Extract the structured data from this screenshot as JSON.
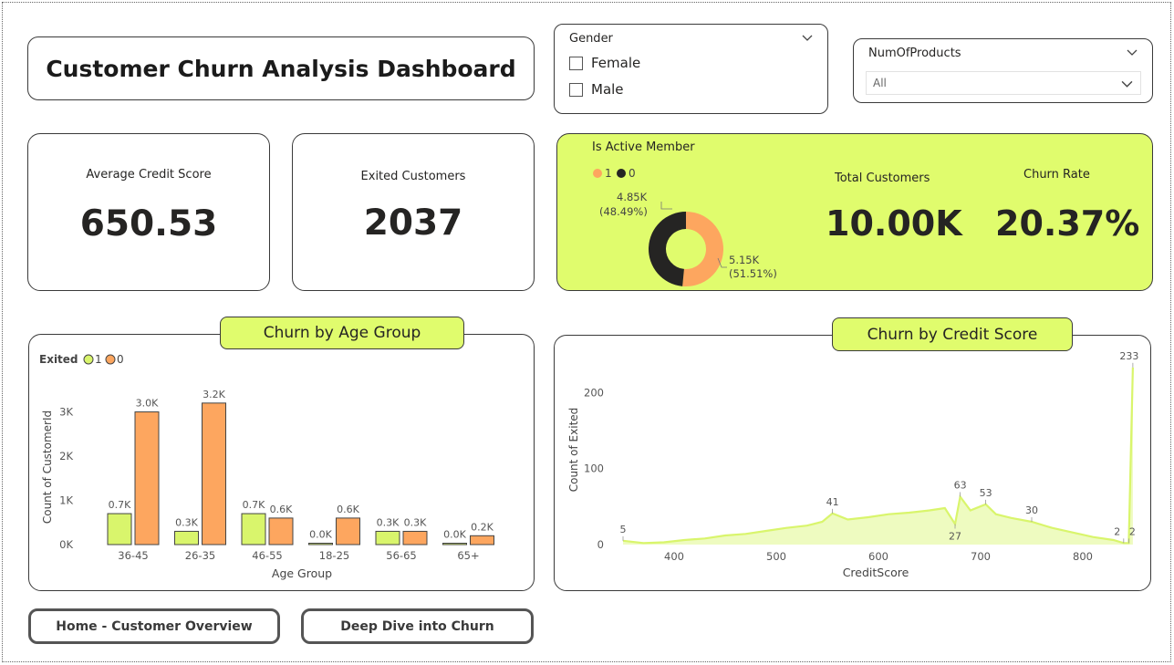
{
  "page": {
    "title": "Customer Churn Analysis Dashboard"
  },
  "filters": {
    "gender": {
      "label": "Gender",
      "options": [
        "Female",
        "Male"
      ]
    },
    "num_products": {
      "label": "NumOfProducts",
      "selected": "All"
    }
  },
  "kpis": {
    "avg_credit": {
      "label": "Average Credit Score",
      "value": "650.53"
    },
    "exited": {
      "label": "Exited Customers",
      "value": "2037"
    },
    "total": {
      "label": "Total Customers",
      "value": "10.00K"
    },
    "churn_rate": {
      "label": "Churn Rate",
      "value": "20.37%"
    }
  },
  "active_member": {
    "title": "Is Active Member",
    "legend": [
      "1",
      "0"
    ],
    "labels": {
      "a_value": "4.85K",
      "a_pct": "(48.49%)",
      "b_value": "5.15K",
      "b_pct": "(51.51%)"
    }
  },
  "age_panel": {
    "title": "Churn by Age Group"
  },
  "credit_panel": {
    "title": "Churn by Credit Score"
  },
  "colors": {
    "accent": "#e0fc6d",
    "lime_bar": "#d9f56c",
    "orange": "#fda65f",
    "dark": "#252423"
  },
  "nav": {
    "home": "Home - Customer Overview",
    "deep": "Deep Dive into Churn"
  },
  "chart_data": [
    {
      "type": "pie",
      "title": "Is Active Member",
      "categories": [
        "1",
        "0"
      ],
      "values": [
        4850,
        5150
      ],
      "percents": [
        "51.51%",
        "48.49%"
      ],
      "value_labels": [
        "5.15K",
        "4.85K"
      ]
    },
    {
      "type": "bar",
      "legend_title": "Exited",
      "categories": [
        "36-45",
        "26-35",
        "46-55",
        "18-25",
        "56-65",
        "65+"
      ],
      "series": [
        {
          "name": "1",
          "values": [
            0.7,
            0.3,
            0.7,
            0.0,
            0.3,
            0.0
          ],
          "labels": [
            "0.7K",
            "0.3K",
            "0.7K",
            "0.0K",
            "0.3K",
            "0.0K"
          ]
        },
        {
          "name": "0",
          "values": [
            3.0,
            3.2,
            0.6,
            0.6,
            0.3,
            0.2
          ],
          "labels": [
            "3.0K",
            "3.2K",
            "0.6K",
            "0.6K",
            "0.3K",
            "0.2K"
          ]
        }
      ],
      "xlabel": "Age Group",
      "ylabel": "Count of CustomerId",
      "yticks": [
        "0K",
        "1K",
        "2K",
        "3K"
      ],
      "ylim": [
        0,
        3.3
      ]
    },
    {
      "type": "area",
      "xlabel": "CreditScore",
      "ylabel": "Count of Exited",
      "xlim": [
        350,
        850
      ],
      "ylim": [
        0,
        240
      ],
      "xticks": [
        "400",
        "500",
        "600",
        "700",
        "800"
      ],
      "yticks": [
        "0",
        "100",
        "200"
      ],
      "points": [
        [
          350,
          5
        ],
        [
          370,
          2
        ],
        [
          390,
          3
        ],
        [
          410,
          6
        ],
        [
          430,
          8
        ],
        [
          450,
          12
        ],
        [
          470,
          14
        ],
        [
          490,
          18
        ],
        [
          510,
          22
        ],
        [
          530,
          25
        ],
        [
          545,
          30
        ],
        [
          555,
          41
        ],
        [
          570,
          33
        ],
        [
          590,
          36
        ],
        [
          610,
          40
        ],
        [
          630,
          42
        ],
        [
          650,
          45
        ],
        [
          665,
          48
        ],
        [
          675,
          27
        ],
        [
          680,
          63
        ],
        [
          690,
          45
        ],
        [
          705,
          53
        ],
        [
          715,
          40
        ],
        [
          730,
          35
        ],
        [
          750,
          30
        ],
        [
          770,
          22
        ],
        [
          790,
          16
        ],
        [
          810,
          10
        ],
        [
          830,
          6
        ],
        [
          840,
          2
        ],
        [
          845,
          2
        ],
        [
          849,
          233
        ]
      ],
      "annotations": [
        {
          "x": 350,
          "y": 5,
          "label": "5"
        },
        {
          "x": 555,
          "y": 41,
          "label": "41"
        },
        {
          "x": 680,
          "y": 63,
          "label": "63"
        },
        {
          "x": 675,
          "y": 27,
          "label": "27"
        },
        {
          "x": 705,
          "y": 53,
          "label": "53"
        },
        {
          "x": 750,
          "y": 30,
          "label": "30"
        },
        {
          "x": 840,
          "y": 2,
          "label": "2"
        },
        {
          "x": 845,
          "y": 2,
          "label": "2"
        },
        {
          "x": 849,
          "y": 233,
          "label": "233"
        }
      ]
    }
  ]
}
